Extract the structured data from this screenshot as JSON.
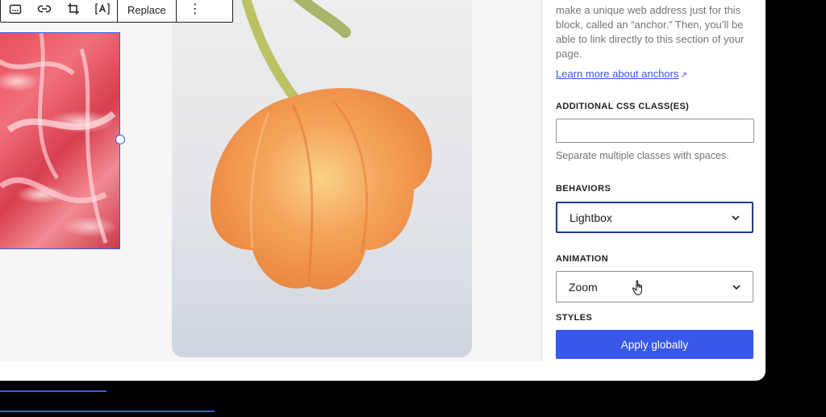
{
  "toolbar": {
    "replace_label": "Replace",
    "more_label": "⋮",
    "icons": [
      "caption-icon",
      "link-icon",
      "crop-icon",
      "text-over-image-icon"
    ]
  },
  "sidebar": {
    "anchor_help": "make a unique web address just for this block, called an “anchor.” Then, you’ll be able to link directly to this section of your page.",
    "learn_more_label": "Learn more about anchors",
    "css_class_label": "ADDITIONAL CSS CLASS(ES)",
    "css_class_value": "",
    "css_class_help": "Separate multiple classes with spaces.",
    "behaviors_label": "BEHAVIORS",
    "behaviors_value": "Lightbox",
    "animation_label": "ANIMATION",
    "animation_value": "Zoom",
    "styles_label": "STYLES",
    "apply_label": "Apply globally"
  },
  "colors": {
    "accent": "#3858e9",
    "focus_border": "#1e3a8a",
    "help_text": "#757575"
  }
}
